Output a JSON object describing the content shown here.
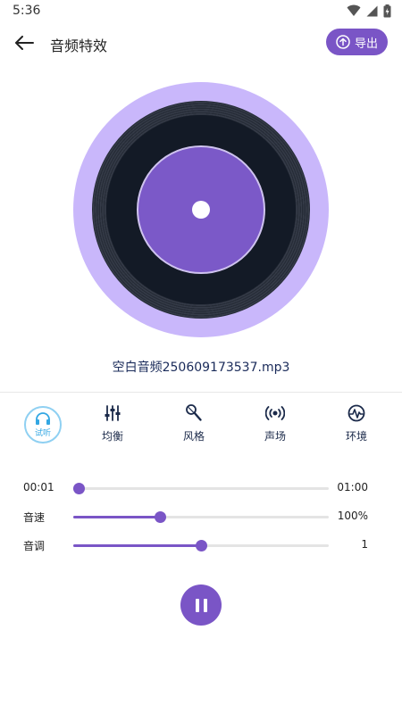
{
  "status_bar": {
    "time": "5:36"
  },
  "header": {
    "title": "音频特效",
    "export_label": "导出"
  },
  "disc": {
    "file_name": "空白音频250609173537.mp3"
  },
  "tabs": [
    {
      "label": "试听",
      "icon": "headphones-icon",
      "active": true
    },
    {
      "label": "均衡",
      "icon": "equalizer-icon"
    },
    {
      "label": "风格",
      "icon": "microphone-icon"
    },
    {
      "label": "声场",
      "icon": "sound-field-icon"
    },
    {
      "label": "环境",
      "icon": "environment-icon"
    }
  ],
  "sliders": {
    "progress": {
      "label": "00:01",
      "value": "01:00",
      "fraction": 0.02
    },
    "speed": {
      "label": "音速",
      "value": "100%",
      "fraction": 0.34
    },
    "pitch": {
      "label": "音调",
      "value": "1",
      "fraction": 0.5
    }
  },
  "colors": {
    "accent": "#7a55c6",
    "disc_outer": "#c9b7fb",
    "active_tab": "#33a7e3",
    "text_dark": "#1b2a4a"
  }
}
